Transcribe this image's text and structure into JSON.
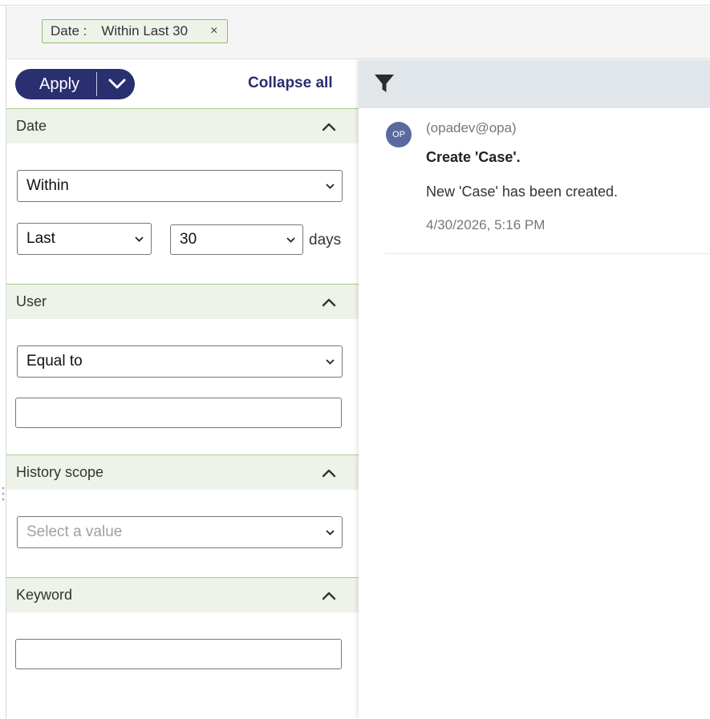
{
  "filter_chip": {
    "key": "Date :",
    "value": "Within Last 30",
    "close_glyph": "×"
  },
  "toolbar": {
    "apply_label": "Apply",
    "collapse_all_label": "Collapse all"
  },
  "sections": {
    "date": {
      "title": "Date",
      "operator": "Within",
      "range": "Last",
      "amount": "30",
      "unit": "days"
    },
    "user": {
      "title": "User",
      "operator": "Equal to",
      "value": ""
    },
    "history_scope": {
      "title": "History scope",
      "placeholder": "Select a value"
    },
    "keyword": {
      "title": "Keyword",
      "value": ""
    }
  },
  "history": {
    "entries": [
      {
        "avatar_initials": "OP",
        "user": "(opadev@opa)",
        "title": "Create 'Case'.",
        "description": "New 'Case' has been created.",
        "timestamp": "4/30/2026, 5:16 PM"
      }
    ]
  },
  "icons": {
    "filter": "filter-icon",
    "chevron_down": "chevron-down-icon",
    "chevron_up": "chevron-up-icon",
    "close": "close-icon"
  },
  "colors": {
    "primary": "#2a2f6f",
    "section_bg": "#eef3ea",
    "section_border": "#a7cc8d",
    "chip_bg": "#edf3e9",
    "chip_border": "#8fbf6e",
    "toolbar_bg": "#e0e6ea",
    "avatar_bg": "#5a6aa0"
  }
}
